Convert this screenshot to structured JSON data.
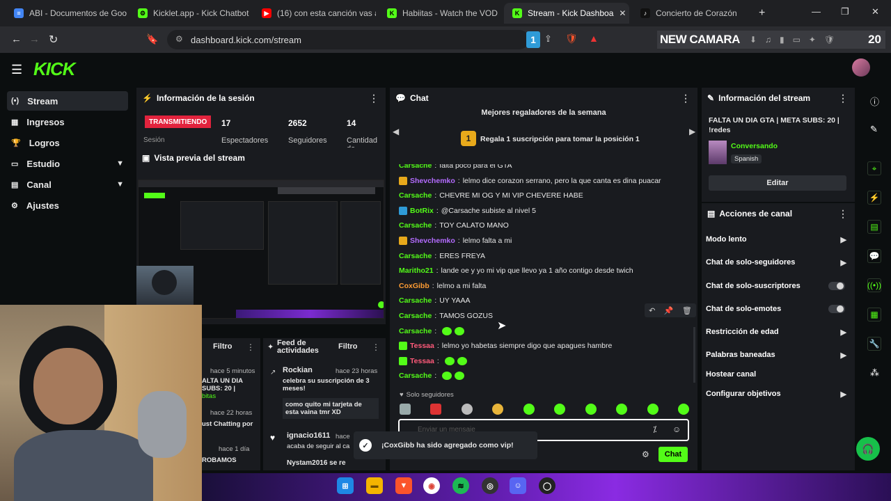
{
  "browser": {
    "tabs": [
      {
        "title": "ABI - Documentos de Goo",
        "color": "#4285f4",
        "glyph": "≡"
      },
      {
        "title": "Kicklet.app - Kick Chatbot",
        "color": "#53fc18",
        "glyph": "⚙"
      },
      {
        "title": "(16) con esta canción vas a",
        "color": "#ff0000",
        "glyph": "▶"
      },
      {
        "title": "Habiitas - Watch the VOD",
        "color": "#53fc18",
        "glyph": "K"
      },
      {
        "title": "Stream - Kick Dashboa",
        "color": "#53fc18",
        "glyph": "K"
      },
      {
        "title": "Concierto de Corazón",
        "color": "#111111",
        "glyph": "♪"
      }
    ],
    "url": "dashboard.kick.com/stream",
    "overlay_text": "NEW CAMARA",
    "overlay_count": "20",
    "ext_badge": "1"
  },
  "sidebar": {
    "items": [
      {
        "label": "Stream",
        "icon": "(•)"
      },
      {
        "label": "Ingresos",
        "icon": "▦"
      },
      {
        "label": "Logros",
        "icon": "🏆"
      },
      {
        "label": "Estudio",
        "icon": "▭"
      },
      {
        "label": "Canal",
        "icon": "▤"
      },
      {
        "label": "Ajustes",
        "icon": "⚙"
      }
    ]
  },
  "session": {
    "title": "Información de la sesión",
    "live_badge": "TRANSMITIENDO",
    "session_label": "Sesión",
    "stats": [
      {
        "value": "17",
        "label": "Espectadores"
      },
      {
        "value": "2652",
        "label": "Seguidores"
      },
      {
        "value": "14",
        "label": "Cantidad de"
      }
    ],
    "preview_title": "Vista previa del stream"
  },
  "lower_left": {
    "filter1": "Filtro",
    "filter_items": [
      {
        "time": "hace 5 minutos",
        "text": "ALTA UN DIA SUBS: 20 |"
      },
      {
        "time": "hace 22 horas",
        "text": "ust Chatting por"
      },
      {
        "time": "hace 1 día",
        "text": "ROBAMOS"
      }
    ],
    "filter_green": "bitas",
    "feed_title": "Feed de actividades",
    "filter2": "Filtro",
    "feed": [
      {
        "user": "Rockian",
        "time": "hace 23 horas",
        "text": "celebra su suscripción de 3 meses!",
        "msg": "como quito mi tarjeta de esta vaina tmr XD"
      },
      {
        "user": "ignacio1611",
        "time": "hace",
        "text": "acaba de seguir al ca"
      },
      {
        "user": "Nystam2016 se re",
        "time": "",
        "text": ""
      }
    ]
  },
  "chat": {
    "title": "Chat",
    "gifters_title": "Mejores regaladores de la semana",
    "gift_pos": "1",
    "gift_text": "Regala 1 suscripción para tomar la posición 1",
    "messages": [
      {
        "user": "Carsache",
        "color": "#53fc18",
        "text": "falta poco para el GTA"
      },
      {
        "user": "Shevchemko",
        "color": "#b46cff",
        "text": "lelmo dice corazon serrano, pero la que canta es dina puacar"
      },
      {
        "user": "Carsache",
        "color": "#53fc18",
        "text": "CHEVRE MI OG Y MI VIP CHEVERE HABE"
      },
      {
        "user": "BotRix",
        "color": "#53fc18",
        "text": "@Carsache subiste al nivel 5"
      },
      {
        "user": "Carsache",
        "color": "#53fc18",
        "text": "TOY CALATO MANO"
      },
      {
        "user": "Shevchemko",
        "color": "#b46cff",
        "text": "lelmo falta a mi"
      },
      {
        "user": "Carsache",
        "color": "#53fc18",
        "text": "ERES FREYA"
      },
      {
        "user": "Maritho21",
        "color": "#53fc18",
        "text": "lande oe y yo mi vip que llevo ya 1 año contigo desde twich"
      },
      {
        "user": "CoxGibb",
        "color": "#ff9c33",
        "text": "lelmo a mi falta"
      },
      {
        "user": "Carsache",
        "color": "#53fc18",
        "text": "UY YAAA"
      },
      {
        "user": "Carsache",
        "color": "#53fc18",
        "text": "TAMOS GOZUS"
      },
      {
        "user": "Carsache",
        "color": "#53fc18",
        "text": ""
      },
      {
        "user": "Tessaa",
        "color": "#ff5a7a",
        "text": "lelmo yo habetas siempre digo que apagues hambre"
      },
      {
        "user": "Tessaa",
        "color": "#ff5a7a",
        "text": ""
      },
      {
        "user": "Carsache",
        "color": "#53fc18",
        "text": ""
      }
    ],
    "followers_only": "Solo seguidores",
    "input_placeholder": "Enviar un mensaje",
    "toast": "¡CoxGibb ha sido agregado como vip!",
    "send_label": "Chat"
  },
  "stream_info": {
    "title": "Información del stream",
    "stream_title": "FALTA UN DIA GTA | META SUBS: 20 | !redes",
    "category": "Conversando",
    "language": "Spanish",
    "edit_label": "Editar"
  },
  "channel_actions": {
    "title": "Acciones de canal",
    "items": [
      {
        "label": "Modo lento",
        "kind": "arrow"
      },
      {
        "label": "Chat de solo-seguidores",
        "kind": "arrow"
      },
      {
        "label": "Chat de solo-suscriptores",
        "kind": "toggle"
      },
      {
        "label": "Chat de solo-emotes",
        "kind": "toggle"
      },
      {
        "label": "Restricción de edad",
        "kind": "arrow"
      },
      {
        "label": "Palabras baneadas",
        "kind": "arrow"
      },
      {
        "label": "Hostear canal",
        "kind": "none"
      },
      {
        "label": "Configurar objetivos",
        "kind": "arrow"
      }
    ]
  },
  "colors": {
    "kick_green": "#53fc18",
    "live_red": "#e2233d",
    "panel_bg": "#191b1f"
  }
}
